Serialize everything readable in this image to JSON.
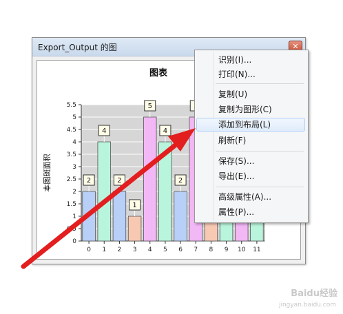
{
  "window": {
    "title": "Export_Output 的图",
    "close_glyph": "✕"
  },
  "chart_data": {
    "type": "bar",
    "title": "图表",
    "ylabel": "本图斑面积",
    "xlabel": "",
    "categories": [
      "0",
      "1",
      "2",
      "3",
      "4",
      "5",
      "6",
      "7",
      "8",
      "9",
      "10",
      "11"
    ],
    "values": [
      2,
      4,
      2,
      1,
      5,
      4,
      2,
      5,
      3,
      3,
      5,
      1
    ],
    "data_labels": [
      "2",
      "4",
      "2",
      "1",
      "5",
      "4",
      "2",
      "5"
    ],
    "bar_colors": [
      "#b8cff7",
      "#b8f5dc",
      "#b8cff7",
      "#f7c9b3",
      "#f2b7f5",
      "#b8f5dc",
      "#b8cff7",
      "#f2b7f5",
      "#f7c9b3",
      "#b8f5dc",
      "#f2b7f5",
      "#b8f5dc"
    ],
    "ylim": [
      0,
      5.5
    ],
    "yticks": [
      "0",
      "0.5",
      "1",
      "1.5",
      "2",
      "2.5",
      "3",
      "3.5",
      "4",
      "4.5",
      "5",
      "5.5"
    ],
    "grid": true
  },
  "context_menu": {
    "items": [
      {
        "label": "识别(I)..."
      },
      {
        "label": "打印(N)..."
      },
      {
        "label": "复制(U)"
      },
      {
        "label": "复制为图形(C)"
      },
      {
        "label": "添加到布局(L)"
      },
      {
        "label": "刷新(F)"
      },
      {
        "label": "保存(S)..."
      },
      {
        "label": "导出(E)..."
      },
      {
        "label": "高级属性(A)..."
      },
      {
        "label": "属性(P)..."
      }
    ],
    "highlighted_index": 4
  },
  "annotation": {
    "arrow_color": "#e31e1e"
  },
  "watermark": {
    "text": "Baidu经验",
    "url": "jingyan.baidu.com"
  }
}
